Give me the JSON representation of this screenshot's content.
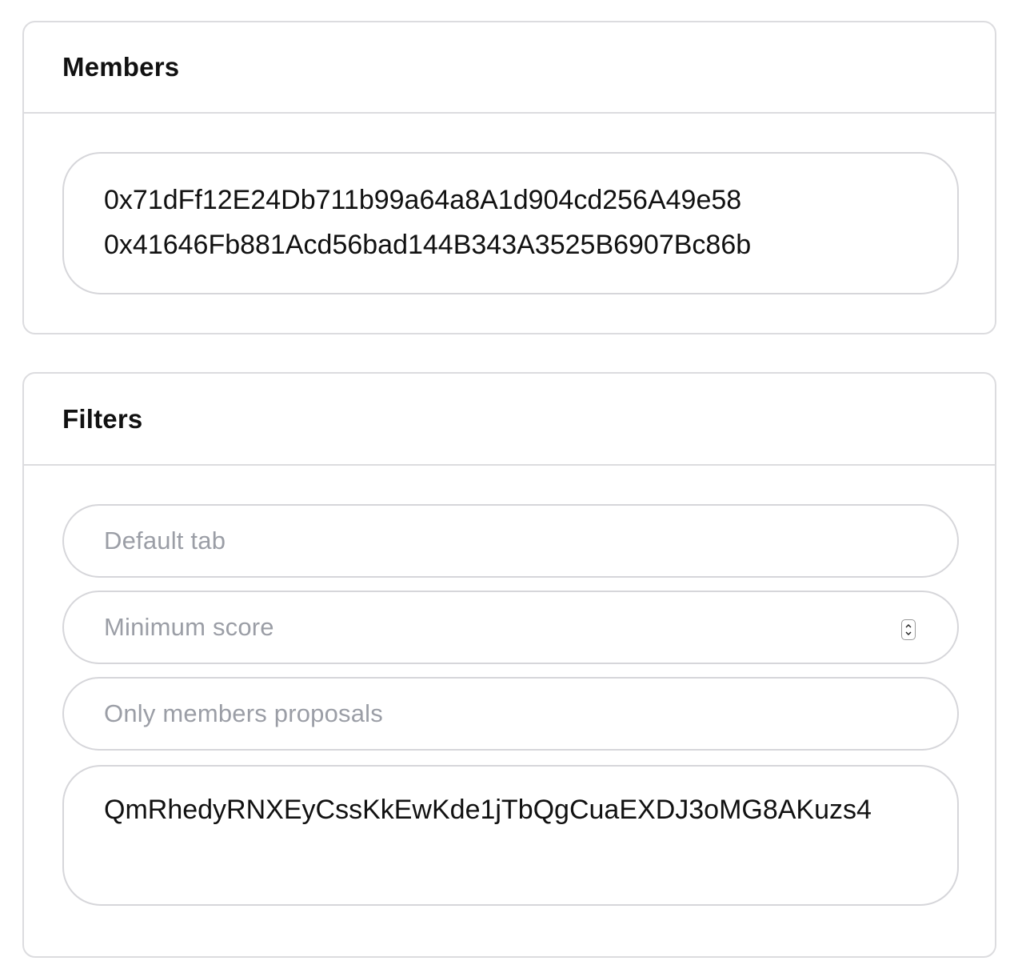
{
  "members": {
    "title": "Members",
    "addresses": [
      "0x71dFf12E24Db711b99a64a8A1d904cd256A49e58",
      "0x41646Fb881Acd56bad144B343A3525B6907Bc86b"
    ]
  },
  "filters": {
    "title": "Filters",
    "default_tab": {
      "placeholder": "Default tab",
      "value": ""
    },
    "minimum_score": {
      "placeholder": "Minimum score",
      "value": ""
    },
    "only_members_proposals": {
      "placeholder": "Only members proposals",
      "value": ""
    },
    "strategies_text": "QmRhedyRNXEyCssKkEwKde1jTbQgCuaEXDJ3oMG8AKuzs4"
  },
  "icons": {
    "stepper": "number-stepper-icon"
  },
  "colors": {
    "border": "#dcdcdf",
    "placeholder": "#9b9ea6",
    "text": "#111111"
  }
}
